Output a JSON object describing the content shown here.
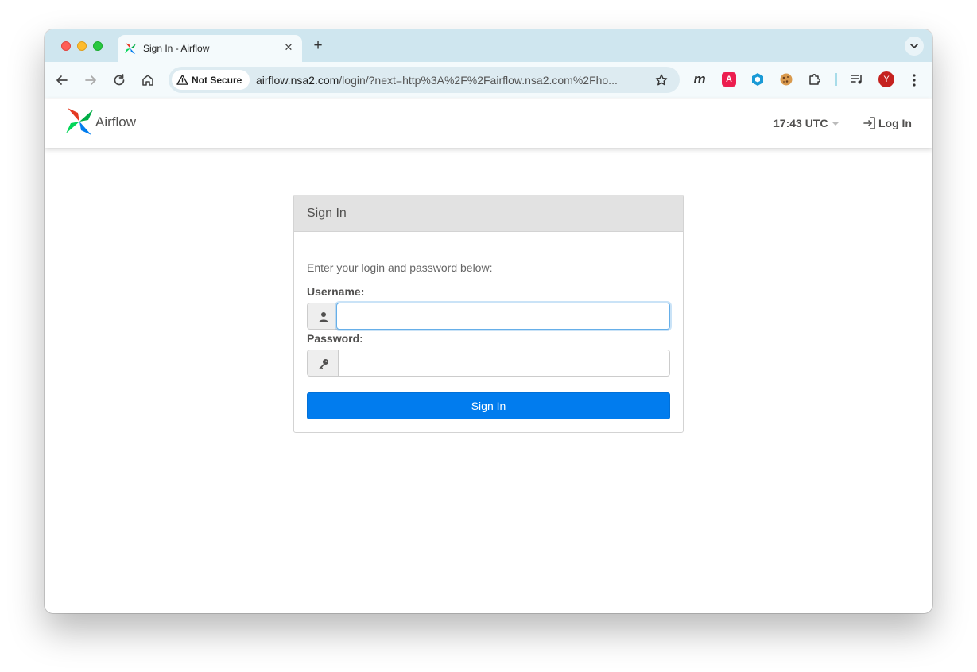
{
  "browser": {
    "tab_title": "Sign In - Airflow",
    "tab_close": "✕",
    "new_tab": "+",
    "security_label": "Not Secure",
    "url_host": "airflow.nsa2.com",
    "url_rest": "/login/?next=http%3A%2F%2Fairflow.nsa2.com%2Fho...",
    "extension_m": "m",
    "extension_red": "A",
    "avatar_initial": "Y"
  },
  "navbar": {
    "brand": "Airflow",
    "clock": "17:43 UTC",
    "login_label": "Log In"
  },
  "login_panel": {
    "heading": "Sign In",
    "intro": "Enter your login and password below:",
    "username_label": "Username:",
    "username_value": "",
    "password_label": "Password:",
    "password_value": "",
    "submit_label": "Sign In"
  },
  "colors": {
    "tab_strip": "#cfe6ef",
    "toolbar": "#f4fafc",
    "primary_button": "#017cee",
    "focus_ring": "#66afe9"
  }
}
